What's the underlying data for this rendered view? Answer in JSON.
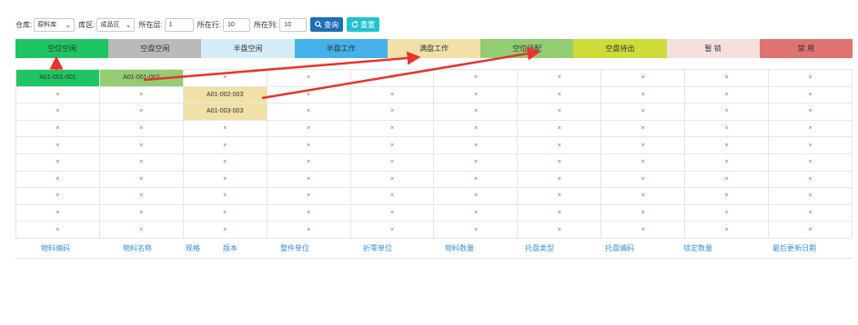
{
  "filters": {
    "warehouse": {
      "label": "仓库:",
      "value": "原料库"
    },
    "area": {
      "label": "库区:",
      "value": "成品区"
    },
    "layer": {
      "label": "所在层:",
      "value": "1"
    },
    "row": {
      "label": "所在行:",
      "value": "10"
    },
    "col": {
      "label": "所在列:",
      "value": "10"
    },
    "query_button": "查询",
    "reset_button": "重置"
  },
  "legend": [
    {
      "label": "空位空闲",
      "color": "#1fc463"
    },
    {
      "label": "空盘空闲",
      "color": "#bdb9b9"
    },
    {
      "label": "半盘空闲",
      "color": "#d6ecf7"
    },
    {
      "label": "半盘工作",
      "color": "#45b1ea"
    },
    {
      "label": "满盘工作",
      "color": "#f1e1a6"
    },
    {
      "label": "空位待配",
      "color": "#94cc74"
    },
    {
      "label": "空盘待出",
      "color": "#cddc38"
    },
    {
      "label": "暂 锁",
      "color": "#f4dede"
    },
    {
      "label": "禁 用",
      "color": "#df7372"
    }
  ],
  "grid": {
    "empty_symbol": "×",
    "rows": [
      [
        "A01-001-001",
        "A01-001-002",
        "×",
        "×",
        "×",
        "×",
        "×",
        "×",
        "×",
        "×"
      ],
      [
        "×",
        "×",
        "A01-002-003",
        "×",
        "×",
        "×",
        "×",
        "×",
        "×",
        "×"
      ],
      [
        "×",
        "×",
        "A01-003-003",
        "×",
        "×",
        "×",
        "×",
        "×",
        "×",
        "×"
      ],
      [
        "×",
        "×",
        "×",
        "×",
        "×",
        "×",
        "×",
        "×",
        "×",
        "×"
      ],
      [
        "×",
        "×",
        "×",
        "×",
        "×",
        "×",
        "×",
        "×",
        "×",
        "×"
      ],
      [
        "×",
        "×",
        "×",
        "×",
        "×",
        "×",
        "×",
        "×",
        "×",
        "×"
      ],
      [
        "×",
        "×",
        "×",
        "×",
        "×",
        "×",
        "×",
        "×",
        "×",
        "×"
      ],
      [
        "×",
        "×",
        "×",
        "×",
        "×",
        "×",
        "×",
        "×",
        "×",
        "×"
      ],
      [
        "×",
        "×",
        "×",
        "×",
        "×",
        "×",
        "×",
        "×",
        "×",
        "×"
      ],
      [
        "×",
        "×",
        "×",
        "×",
        "×",
        "×",
        "×",
        "×",
        "×",
        "×"
      ]
    ],
    "occupied_colors": {
      "A01-001-001": "#1fc463",
      "A01-001-002": "#94cc74",
      "A01-002-003": "#f1e1a6",
      "A01-003-003": "#f1e1a6"
    }
  },
  "table_headers": [
    "物料编码",
    "物料名称",
    "规格",
    "版本",
    "整件单位",
    "折零单位",
    "物料数量",
    "托盘类型",
    "托盘编码",
    "锁定数量",
    "最后更新日期"
  ],
  "annotation_color": "#e8342c"
}
